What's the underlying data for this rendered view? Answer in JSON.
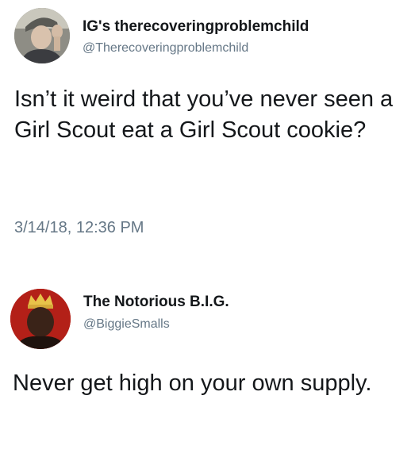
{
  "tweets": [
    {
      "display_name": "IG's therecoveringproblemchild",
      "handle": "@Therecoveringproblemchild",
      "text": "Isn’t it weird that you’ve never seen a Girl Scout eat a Girl Scout cookie?",
      "timestamp": "3/14/18, 12:36 PM",
      "avatar_icon": "profile-photo-man-with-hat"
    },
    {
      "display_name": "The Notorious B.I.G.",
      "handle": "@BiggieSmalls",
      "text": "Never get high on your own supply.",
      "avatar_icon": "profile-photo-man-with-crown"
    }
  ],
  "colors": {
    "text_primary": "#14171a",
    "text_secondary": "#657786",
    "background": "#ffffff",
    "avatar2_background": "#b32018"
  }
}
